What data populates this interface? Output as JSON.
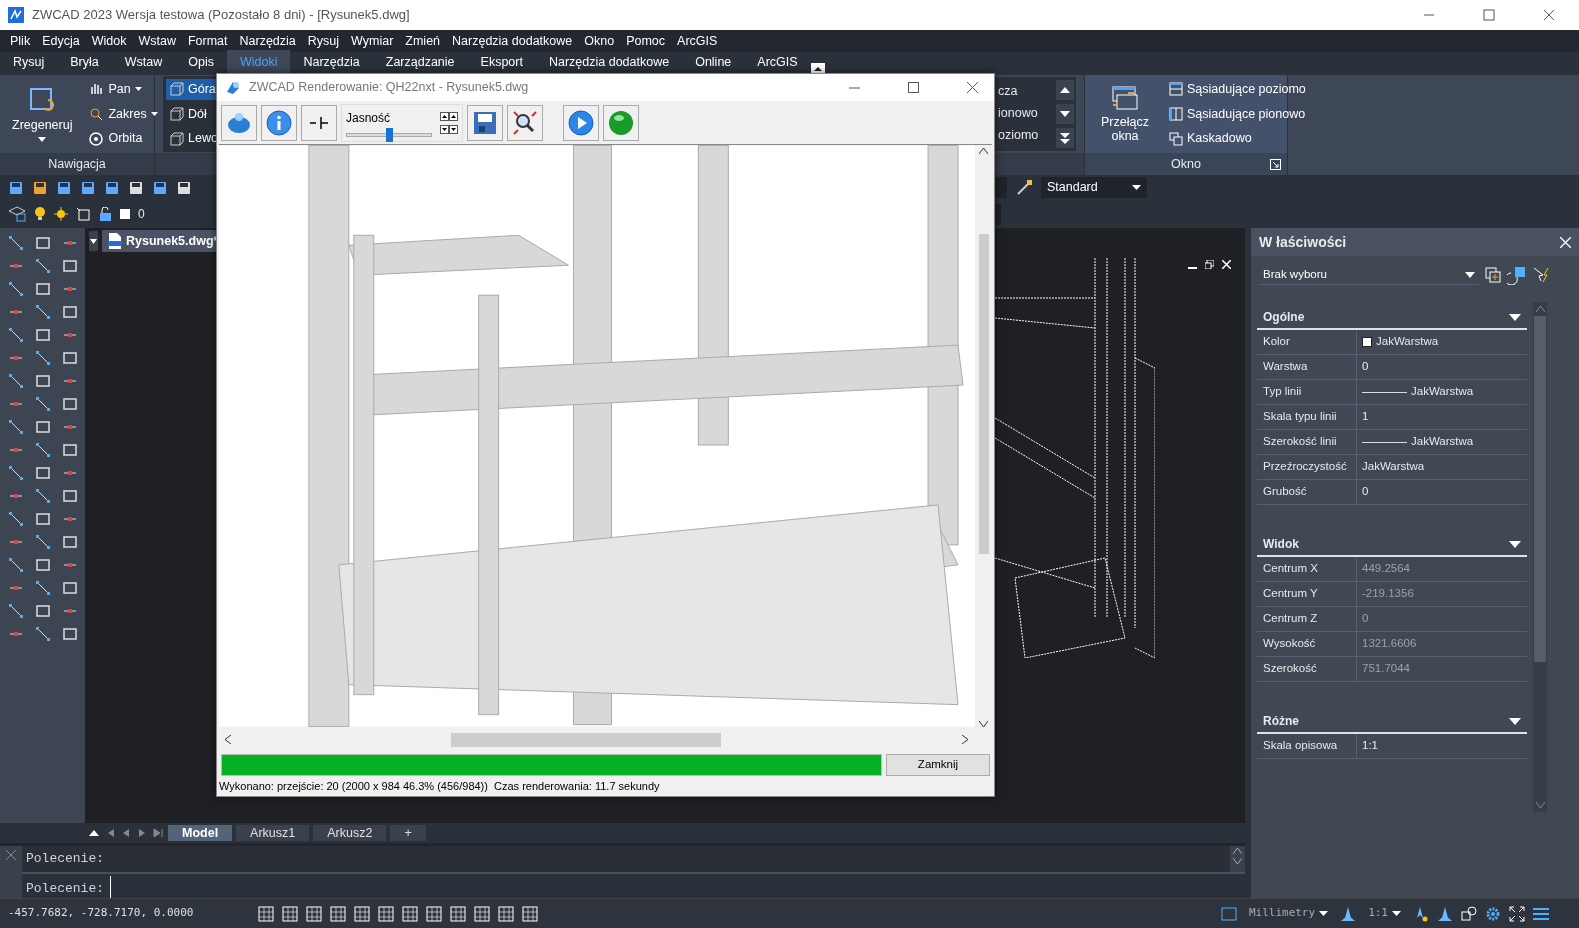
{
  "window": {
    "title": "ZWCAD 2023 Wersja testowa (Pozostało 8 dni) - [Rysunek5.dwg]"
  },
  "menu": [
    "Plik",
    "Edycja",
    "Widok",
    "Wstaw",
    "Format",
    "Narzędzia",
    "Rysuj",
    "Wymiar",
    "Zmień",
    "Narzędzia dodatkowe",
    "Okno",
    "Pomoc",
    "ArcGIS"
  ],
  "ribbon_tabs": [
    {
      "label": "Rysuj",
      "selected": false
    },
    {
      "label": "Bryła",
      "selected": false
    },
    {
      "label": "Wstaw",
      "selected": false
    },
    {
      "label": "Opis",
      "selected": false
    },
    {
      "label": "Widoki",
      "selected": true
    },
    {
      "label": "Narzędzia",
      "selected": false
    },
    {
      "label": "Zarządzanie",
      "selected": false
    },
    {
      "label": "Eksport",
      "selected": false
    },
    {
      "label": "Narzędzia dodatkowe",
      "selected": false
    },
    {
      "label": "Online",
      "selected": false
    },
    {
      "label": "ArcGIS",
      "selected": false
    }
  ],
  "navigation_panel": {
    "title": "Nawigacja",
    "big_button": "Zregeneruj",
    "buttons": [
      {
        "label": "Pan",
        "has_menu": true
      },
      {
        "label": "Zakres",
        "has_menu": true
      },
      {
        "label": "Orbita",
        "has_menu": false
      }
    ]
  },
  "views_panel": {
    "views": [
      {
        "label": "Góra",
        "selected": true
      },
      {
        "label": "Dół",
        "selected": false
      },
      {
        "label": "Lewo",
        "selected": false
      }
    ],
    "viewports": [
      "cza",
      "ionowo",
      "oziomo"
    ]
  },
  "window_panel": {
    "title": "Okno",
    "big_button": "Przełącz okna",
    "buttons": [
      "Sąsiadujące poziomo",
      "Sąsiadujące pionowo",
      "Kaskadowo"
    ]
  },
  "toolbar": {
    "text_style": "Standard",
    "layer": "0"
  },
  "document_tab": "Rysunek5.dwg*",
  "render_window": {
    "title": "ZWCAD Renderowanie: QH22nxt - Rysunek5.dwg",
    "brightness_label": "Jasność",
    "brightness": {
      "level": 0.5
    },
    "progress": {
      "level": 1
    },
    "close_button": "Zamknij",
    "status": "Wykonano: przejście: 20 (2000 x 984 46.3% (456/984))  Czas renderowania: 11.7 sekundy"
  },
  "properties": {
    "title": "W łaściwości",
    "selection": "Brak wyboru",
    "sections": [
      {
        "title": "Ogólne",
        "expanded": true,
        "rows": [
          {
            "label": "Kolor",
            "value": "JakWarstwa",
            "kind": "color",
            "disabled": false
          },
          {
            "label": "Warstwa",
            "value": "0",
            "kind": "text",
            "disabled": false
          },
          {
            "label": "Typ linii",
            "value": "JakWarstwa",
            "kind": "linetype",
            "disabled": false
          },
          {
            "label": "Skala typu linii",
            "value": "1",
            "kind": "text",
            "disabled": false
          },
          {
            "label": "Szerokość linii",
            "value": "JakWarstwa",
            "kind": "linetype",
            "disabled": false
          },
          {
            "label": "Przeźroczystość",
            "value": "JakWarstwa",
            "kind": "text",
            "disabled": false
          },
          {
            "label": "Grubość",
            "value": "0",
            "kind": "text",
            "disabled": false
          }
        ]
      },
      {
        "title": "Widok",
        "expanded": true,
        "rows": [
          {
            "label": "Centrum X",
            "value": "449.2564",
            "kind": "text",
            "disabled": true
          },
          {
            "label": "Centrum Y",
            "value": "-219.1356",
            "kind": "text",
            "disabled": true
          },
          {
            "label": "Centrum Z",
            "value": "0",
            "kind": "text",
            "disabled": true
          },
          {
            "label": "Wysokość",
            "value": "1321.6606",
            "kind": "text",
            "disabled": true
          },
          {
            "label": "Szerokość",
            "value": "751.7044",
            "kind": "text",
            "disabled": true
          }
        ]
      },
      {
        "title": "Różne",
        "expanded": true,
        "rows": [
          {
            "label": "Skala opisowa",
            "value": "1:1",
            "kind": "text",
            "disabled": false
          }
        ]
      }
    ]
  },
  "layout_tabs": [
    {
      "label": "Model",
      "selected": true
    },
    {
      "label": "Arkusz1",
      "selected": false
    },
    {
      "label": "Arkusz2",
      "selected": false
    },
    {
      "label": "+",
      "selected": false
    }
  ],
  "command_lines": [
    "Polecenie:",
    "Polecenie:"
  ],
  "status_bar": {
    "coordinates": "-457.7682, -728.7170, 0.0000",
    "units": "Millimetry",
    "scale": "1:1"
  }
}
